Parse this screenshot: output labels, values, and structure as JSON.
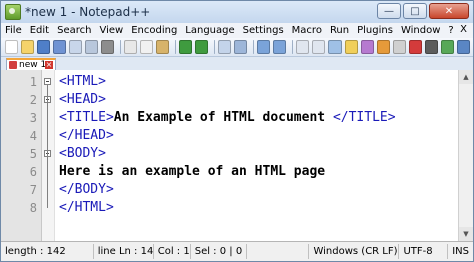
{
  "window": {
    "title": "*new 1 - Notepad++"
  },
  "menu": [
    "File",
    "Edit",
    "Search",
    "View",
    "Encoding",
    "Language",
    "Settings",
    "Macro",
    "Run",
    "Plugins",
    "Window",
    "?"
  ],
  "menu_close": "X",
  "tab": {
    "label": "new 1"
  },
  "lines": [
    {
      "n": "1",
      "parts": [
        {
          "t": "<HTML>",
          "c": "tag"
        }
      ]
    },
    {
      "n": "2",
      "parts": [
        {
          "t": "<HEAD>",
          "c": "tag"
        }
      ]
    },
    {
      "n": "3",
      "parts": [
        {
          "t": "<TITLE>",
          "c": "tag"
        },
        {
          "t": "An Example of HTML document ",
          "c": "txt"
        },
        {
          "t": "</TITLE>",
          "c": "tag"
        }
      ]
    },
    {
      "n": "4",
      "parts": [
        {
          "t": "</HEAD>",
          "c": "tag"
        }
      ]
    },
    {
      "n": "5",
      "parts": [
        {
          "t": "<BODY>",
          "c": "tag"
        }
      ]
    },
    {
      "n": "6",
      "parts": [
        {
          "t": "Here is an example of an HTML page",
          "c": "txt"
        }
      ]
    },
    {
      "n": "7",
      "parts": [
        {
          "t": "</BODY>",
          "c": "tag"
        }
      ]
    },
    {
      "n": "8",
      "parts": [
        {
          "t": "</HTML>",
          "c": "tag"
        }
      ]
    }
  ],
  "status": {
    "length": "length : 142",
    "lines": "line Ln : 14",
    "col": "Col : 1",
    "sel": "Sel : 0 | 0",
    "eol": "Windows (CR LF)",
    "encoding": "UTF-8",
    "mode": "INS"
  },
  "colors": {
    "tag": "#1a1ab8",
    "text": "#000000",
    "tab_accent": "#f3a53b"
  }
}
